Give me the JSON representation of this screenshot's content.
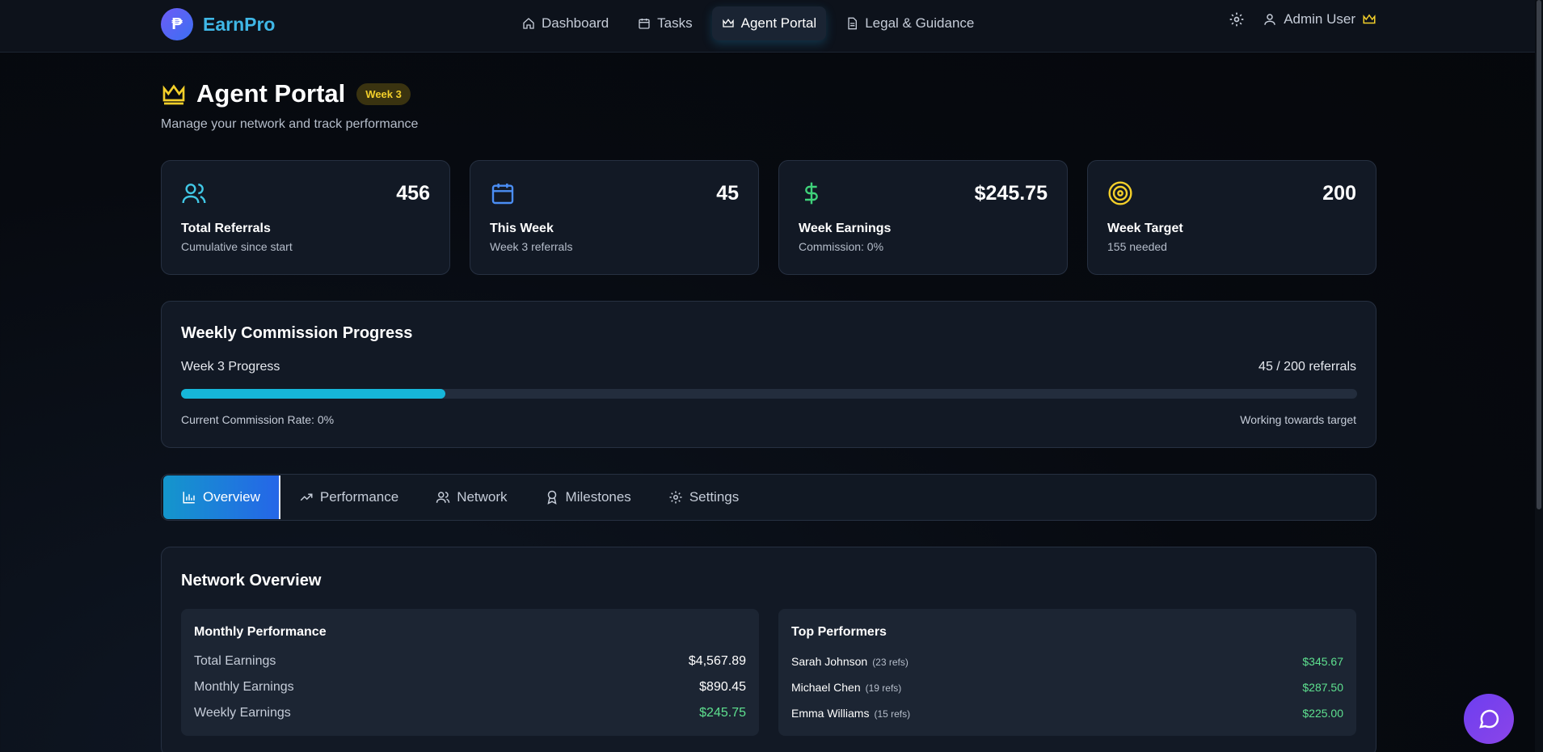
{
  "header": {
    "brand_name": "EarnPro",
    "nav": [
      {
        "label": "Dashboard",
        "icon": "home-icon"
      },
      {
        "label": "Tasks",
        "icon": "calendar-icon"
      },
      {
        "label": "Agent Portal",
        "icon": "crown-icon",
        "active": true
      },
      {
        "label": "Legal & Guidance",
        "icon": "document-icon"
      }
    ],
    "user_name": "Admin User"
  },
  "page": {
    "title": "Agent Portal",
    "week_badge": "Week 3",
    "subtitle": "Manage your network and track performance"
  },
  "stats": [
    {
      "value": "456",
      "label": "Total Referrals",
      "sub": "Cumulative since start",
      "icon": "users-icon",
      "color": "#41c8e6"
    },
    {
      "value": "45",
      "label": "This Week",
      "sub": "Week 3 referrals",
      "icon": "calendar-icon",
      "color": "#4b8ef5"
    },
    {
      "value": "$245.75",
      "label": "Week Earnings",
      "sub": "Commission: 0%",
      "icon": "dollar-icon",
      "color": "#3fd27a"
    },
    {
      "value": "200",
      "label": "Week Target",
      "sub": "155 needed",
      "icon": "target-icon",
      "color": "#f3cf2a"
    }
  ],
  "progress": {
    "title": "Weekly Commission Progress",
    "label": "Week 3 Progress",
    "count": "45 / 200 referrals",
    "fraction": 0.225,
    "rate": "Current Commission Rate: 0%",
    "status": "Working towards target"
  },
  "tabs": [
    {
      "label": "Overview",
      "icon": "bar-chart-icon",
      "active": true
    },
    {
      "label": "Performance",
      "icon": "trending-up-icon"
    },
    {
      "label": "Network",
      "icon": "users-icon"
    },
    {
      "label": "Milestones",
      "icon": "award-icon"
    },
    {
      "label": "Settings",
      "icon": "gear-icon"
    }
  ],
  "overview": {
    "title": "Network Overview",
    "monthly": {
      "title": "Monthly Performance",
      "rows": [
        {
          "label": "Total Earnings",
          "value": "$4,567.89"
        },
        {
          "label": "Monthly Earnings",
          "value": "$890.45"
        },
        {
          "label": "Weekly Earnings",
          "value": "$245.75"
        }
      ]
    },
    "top": {
      "title": "Top Performers",
      "rows": [
        {
          "name": "Sarah Johnson",
          "refs": "(23 refs)",
          "earn": "$345.67"
        },
        {
          "name": "Michael Chen",
          "refs": "(19 refs)",
          "earn": "$287.50"
        },
        {
          "name": "Emma Williams",
          "refs": "(15 refs)",
          "earn": "$225.00"
        }
      ]
    }
  },
  "colors": {
    "accent": "#16b6d9",
    "crown": "#f3cf2a",
    "positive": "#5ee08f"
  }
}
